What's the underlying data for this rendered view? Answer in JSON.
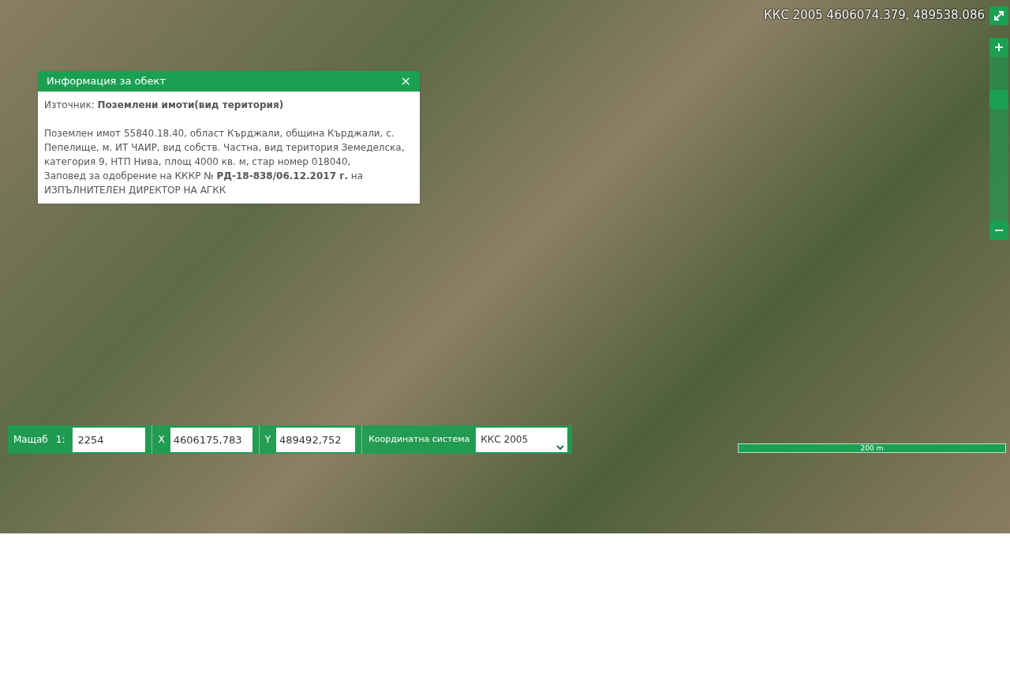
{
  "cursor_coords": "ККС 2005 4606074.379, 489538.086",
  "zoom": {
    "plus": "+",
    "minus": "−",
    "level": 0.77
  },
  "popup": {
    "title": "Информация за обект",
    "close": "×",
    "source": "Източник: **Поземлени имоти(вид територия)**",
    "body": "Поземлен имот 55840.18.40, област Кърджали, община Кърджали, с. Пепелище, м. ИТ ЧАИР, вид собств. Частна, вид територия Земеделска, категория 9, НТП Нива, площ 4000 кв. м, стар номер 018040,\nЗаповед за одобрение на КККР № **РД-18-838/06.12.2017 г.** на ИЗПЪЛНИТЕЛЕН ДИРЕКТОР НА АГКК"
  },
  "controls": {
    "scale_label": "Мащаб",
    "scale_prefix": "1:",
    "scale_value": "2254",
    "x_label": "X",
    "x_value": "4606175,783",
    "y_label": "Y",
    "y_value": "489492,752",
    "crs_label": "Координатна система",
    "crs_value": "ККС 2005"
  },
  "scale_bar": {
    "label": "200 m"
  }
}
